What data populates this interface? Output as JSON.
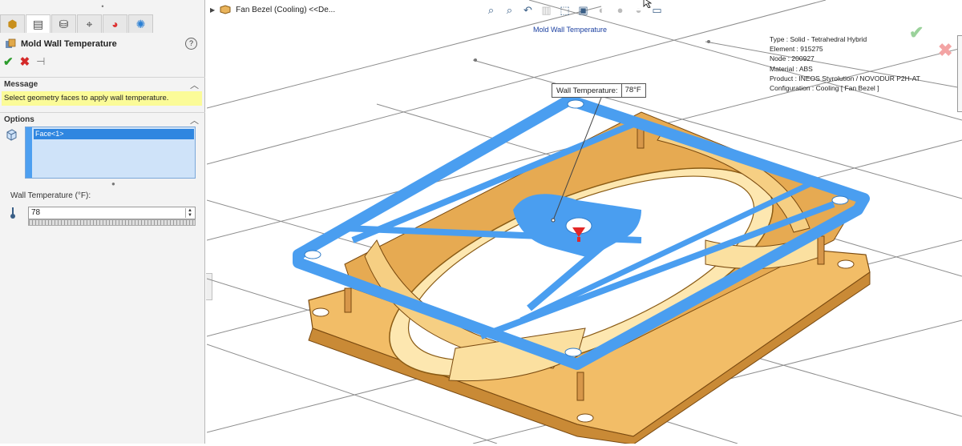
{
  "property_manager": {
    "title": "Mold Wall Temperature",
    "help_label": "?",
    "message_section": "Message",
    "message_text": "Select geometry faces to apply wall temperature.",
    "options_section": "Options",
    "selection_items": [
      "Face<1>"
    ],
    "wall_temp_label": "Wall Temperature (°F):",
    "wall_temp_value": "78"
  },
  "tree_flyout": {
    "label": "Fan Bezel (Cooling)  <<De..."
  },
  "viewport": {
    "title": "Mold Wall Temperature",
    "callout_label": "Wall Temperature:",
    "callout_value": "78°F",
    "info": [
      "Type : Solid - Tetrahedral Hybrid",
      "Element : 915275",
      "Node : 200927",
      "Material : ABS",
      "Product : INEOS Styrolution / NOVODUR P2H-AT",
      "Configuration : Cooling [ Fan Bezel ]"
    ]
  },
  "colors": {
    "part_body": "#e9b45c",
    "selected_face": "#4a9ef0",
    "message_bg": "#fbfb98"
  },
  "icons": {
    "tabs": [
      "feature-manager-icon",
      "property-manager-icon",
      "configuration-manager-icon",
      "dimxpert-icon",
      "display-manager-icon",
      "simulation-icon"
    ],
    "heads_up": [
      "zoom-to-fit-icon",
      "zoom-area-icon",
      "previous-view-icon",
      "section-view-icon",
      "view-orientation-icon",
      "display-style-icon",
      "hide-show-icon",
      "edit-appearance-icon",
      "apply-scene-icon",
      "view-settings-icon"
    ]
  }
}
